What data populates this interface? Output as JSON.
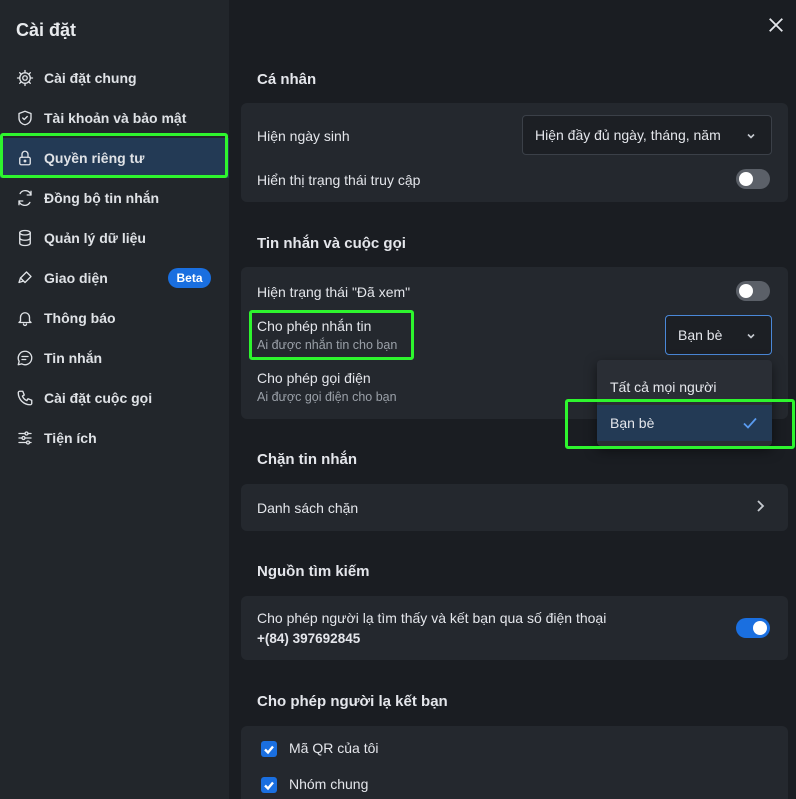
{
  "sidebar": {
    "title": "Cài đặt",
    "items": [
      {
        "label": "Cài đặt chung",
        "icon": "gear-icon"
      },
      {
        "label": "Tài khoản và bảo mật",
        "icon": "shield-icon"
      },
      {
        "label": "Quyền riêng tư",
        "icon": "lock-icon"
      },
      {
        "label": "Đồng bộ tin nhắn",
        "icon": "sync-icon"
      },
      {
        "label": "Quản lý dữ liệu",
        "icon": "database-icon"
      },
      {
        "label": "Giao diện",
        "icon": "paint-brush-icon",
        "badge": "Beta"
      },
      {
        "label": "Thông báo",
        "icon": "bell-icon"
      },
      {
        "label": "Tin nhắn",
        "icon": "message-icon"
      },
      {
        "label": "Cài đặt cuộc gọi",
        "icon": "phone-icon"
      },
      {
        "label": "Tiện ích",
        "icon": "sliders-icon"
      }
    ],
    "active_index": 2
  },
  "sections": {
    "personal": {
      "title": "Cá nhân",
      "birthday_label": "Hiện ngày sinh",
      "birthday_value": "Hiện đầy đủ ngày, tháng, năm",
      "online_status_label": "Hiển thị trạng thái truy cập",
      "online_status_on": false
    },
    "messages_calls": {
      "title": "Tin nhắn và cuộc gọi",
      "seen_label": "Hiện trạng thái \"Đã xem\"",
      "seen_on": false,
      "allow_msg_label": "Cho phép nhắn tin",
      "allow_msg_sub": "Ai được nhắn tin cho bạn",
      "allow_msg_value": "Bạn bè",
      "allow_call_label": "Cho phép gọi điện",
      "allow_call_sub": "Ai được gọi điện cho bạn"
    },
    "dropdown": {
      "options": [
        "Tất cả mọi người",
        "Bạn bè"
      ],
      "selected_index": 1
    },
    "block": {
      "title": "Chặn tin nhắn",
      "list_label": "Danh sách chặn"
    },
    "search_source": {
      "title": "Nguồn tìm kiếm",
      "phone_label": "Cho phép người lạ tìm thấy và kết bạn qua số điện thoại",
      "phone_number": "+(84) 397692845",
      "phone_on": true
    },
    "friend_request": {
      "title": "Cho phép người lạ kết bạn",
      "options": [
        {
          "label": "Mã QR của tôi",
          "checked": true
        },
        {
          "label": "Nhóm chung",
          "checked": true
        }
      ]
    }
  },
  "colors": {
    "accent": "#1a6fe0",
    "highlight": "#2ef52e",
    "active_bg": "#233a55"
  }
}
